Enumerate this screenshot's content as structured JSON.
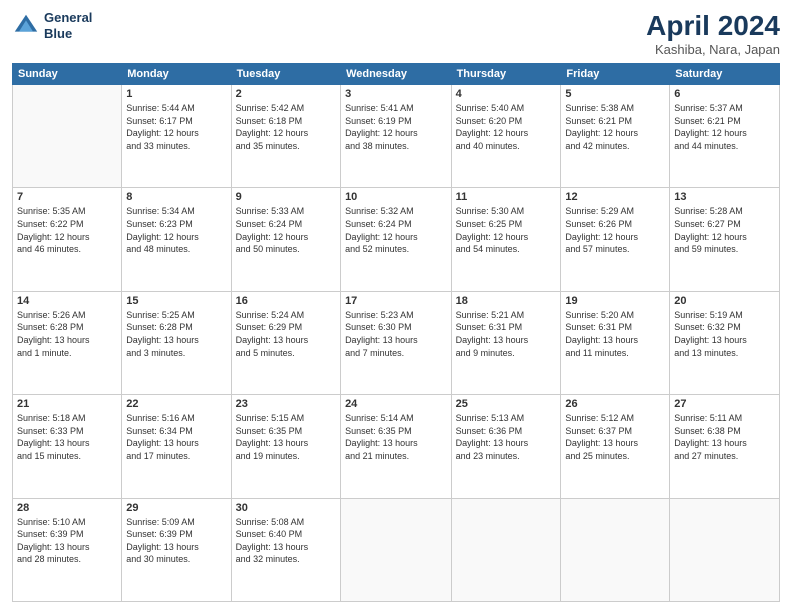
{
  "header": {
    "logo_line1": "General",
    "logo_line2": "Blue",
    "month": "April 2024",
    "location": "Kashiba, Nara, Japan"
  },
  "weekdays": [
    "Sunday",
    "Monday",
    "Tuesday",
    "Wednesday",
    "Thursday",
    "Friday",
    "Saturday"
  ],
  "weeks": [
    [
      {
        "day": null,
        "content": null
      },
      {
        "day": "1",
        "content": "Sunrise: 5:44 AM\nSunset: 6:17 PM\nDaylight: 12 hours\nand 33 minutes."
      },
      {
        "day": "2",
        "content": "Sunrise: 5:42 AM\nSunset: 6:18 PM\nDaylight: 12 hours\nand 35 minutes."
      },
      {
        "day": "3",
        "content": "Sunrise: 5:41 AM\nSunset: 6:19 PM\nDaylight: 12 hours\nand 38 minutes."
      },
      {
        "day": "4",
        "content": "Sunrise: 5:40 AM\nSunset: 6:20 PM\nDaylight: 12 hours\nand 40 minutes."
      },
      {
        "day": "5",
        "content": "Sunrise: 5:38 AM\nSunset: 6:21 PM\nDaylight: 12 hours\nand 42 minutes."
      },
      {
        "day": "6",
        "content": "Sunrise: 5:37 AM\nSunset: 6:21 PM\nDaylight: 12 hours\nand 44 minutes."
      }
    ],
    [
      {
        "day": "7",
        "content": "Sunrise: 5:35 AM\nSunset: 6:22 PM\nDaylight: 12 hours\nand 46 minutes."
      },
      {
        "day": "8",
        "content": "Sunrise: 5:34 AM\nSunset: 6:23 PM\nDaylight: 12 hours\nand 48 minutes."
      },
      {
        "day": "9",
        "content": "Sunrise: 5:33 AM\nSunset: 6:24 PM\nDaylight: 12 hours\nand 50 minutes."
      },
      {
        "day": "10",
        "content": "Sunrise: 5:32 AM\nSunset: 6:24 PM\nDaylight: 12 hours\nand 52 minutes."
      },
      {
        "day": "11",
        "content": "Sunrise: 5:30 AM\nSunset: 6:25 PM\nDaylight: 12 hours\nand 54 minutes."
      },
      {
        "day": "12",
        "content": "Sunrise: 5:29 AM\nSunset: 6:26 PM\nDaylight: 12 hours\nand 57 minutes."
      },
      {
        "day": "13",
        "content": "Sunrise: 5:28 AM\nSunset: 6:27 PM\nDaylight: 12 hours\nand 59 minutes."
      }
    ],
    [
      {
        "day": "14",
        "content": "Sunrise: 5:26 AM\nSunset: 6:28 PM\nDaylight: 13 hours\nand 1 minute."
      },
      {
        "day": "15",
        "content": "Sunrise: 5:25 AM\nSunset: 6:28 PM\nDaylight: 13 hours\nand 3 minutes."
      },
      {
        "day": "16",
        "content": "Sunrise: 5:24 AM\nSunset: 6:29 PM\nDaylight: 13 hours\nand 5 minutes."
      },
      {
        "day": "17",
        "content": "Sunrise: 5:23 AM\nSunset: 6:30 PM\nDaylight: 13 hours\nand 7 minutes."
      },
      {
        "day": "18",
        "content": "Sunrise: 5:21 AM\nSunset: 6:31 PM\nDaylight: 13 hours\nand 9 minutes."
      },
      {
        "day": "19",
        "content": "Sunrise: 5:20 AM\nSunset: 6:31 PM\nDaylight: 13 hours\nand 11 minutes."
      },
      {
        "day": "20",
        "content": "Sunrise: 5:19 AM\nSunset: 6:32 PM\nDaylight: 13 hours\nand 13 minutes."
      }
    ],
    [
      {
        "day": "21",
        "content": "Sunrise: 5:18 AM\nSunset: 6:33 PM\nDaylight: 13 hours\nand 15 minutes."
      },
      {
        "day": "22",
        "content": "Sunrise: 5:16 AM\nSunset: 6:34 PM\nDaylight: 13 hours\nand 17 minutes."
      },
      {
        "day": "23",
        "content": "Sunrise: 5:15 AM\nSunset: 6:35 PM\nDaylight: 13 hours\nand 19 minutes."
      },
      {
        "day": "24",
        "content": "Sunrise: 5:14 AM\nSunset: 6:35 PM\nDaylight: 13 hours\nand 21 minutes."
      },
      {
        "day": "25",
        "content": "Sunrise: 5:13 AM\nSunset: 6:36 PM\nDaylight: 13 hours\nand 23 minutes."
      },
      {
        "day": "26",
        "content": "Sunrise: 5:12 AM\nSunset: 6:37 PM\nDaylight: 13 hours\nand 25 minutes."
      },
      {
        "day": "27",
        "content": "Sunrise: 5:11 AM\nSunset: 6:38 PM\nDaylight: 13 hours\nand 27 minutes."
      }
    ],
    [
      {
        "day": "28",
        "content": "Sunrise: 5:10 AM\nSunset: 6:39 PM\nDaylight: 13 hours\nand 28 minutes."
      },
      {
        "day": "29",
        "content": "Sunrise: 5:09 AM\nSunset: 6:39 PM\nDaylight: 13 hours\nand 30 minutes."
      },
      {
        "day": "30",
        "content": "Sunrise: 5:08 AM\nSunset: 6:40 PM\nDaylight: 13 hours\nand 32 minutes."
      },
      {
        "day": null,
        "content": null
      },
      {
        "day": null,
        "content": null
      },
      {
        "day": null,
        "content": null
      },
      {
        "day": null,
        "content": null
      }
    ]
  ]
}
